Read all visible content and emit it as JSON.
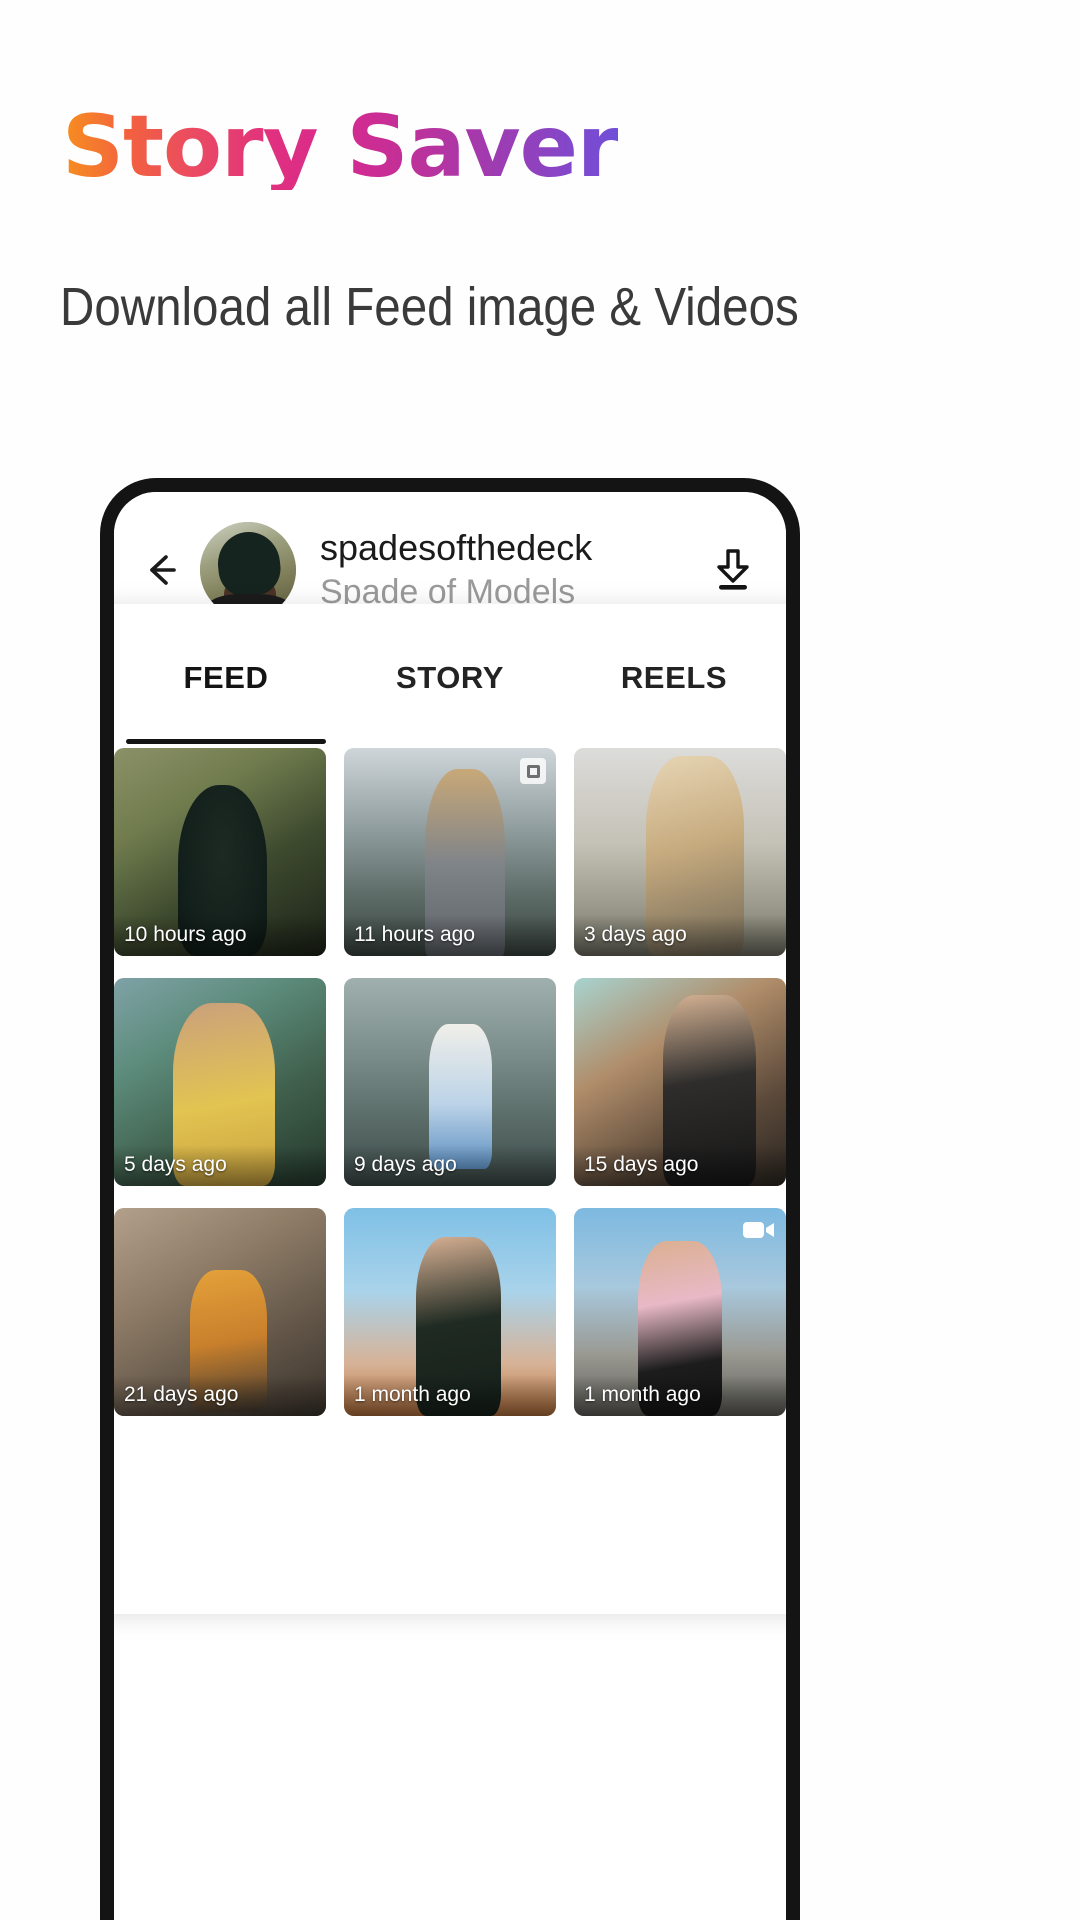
{
  "promo": {
    "title": "Story Saver",
    "subtitle": "Download all Feed image & Videos",
    "gradient_start": "#f7901e",
    "gradient_mid": "#d62a8f",
    "gradient_end": "#6f4fd8"
  },
  "app_header": {
    "back_icon": "arrow-left-icon",
    "avatar": "profile-avatar",
    "account_name": "spadesofthedeck",
    "account_fullname": "Spade of Models",
    "download_icon": "download-icon"
  },
  "tabs": [
    {
      "label": "FEED",
      "active": true
    },
    {
      "label": "STORY",
      "active": false
    },
    {
      "label": "REELS",
      "active": false
    }
  ],
  "grid": {
    "items": [
      {
        "timestamp": "10 hours ago",
        "badge": "none",
        "art": "p1"
      },
      {
        "timestamp": "11 hours ago",
        "badge": "multi",
        "art": "p2"
      },
      {
        "timestamp": "3 days ago",
        "badge": "none",
        "art": "p3"
      },
      {
        "timestamp": "5 days ago",
        "badge": "none",
        "art": "p4"
      },
      {
        "timestamp": "9 days ago",
        "badge": "none",
        "art": "p5"
      },
      {
        "timestamp": "15 days ago",
        "badge": "none",
        "art": "p6"
      },
      {
        "timestamp": "21 days ago",
        "badge": "none",
        "art": "p7"
      },
      {
        "timestamp": "1 month ago",
        "badge": "none",
        "art": "p8"
      },
      {
        "timestamp": "1 month ago",
        "badge": "video",
        "art": "p9"
      }
    ]
  }
}
